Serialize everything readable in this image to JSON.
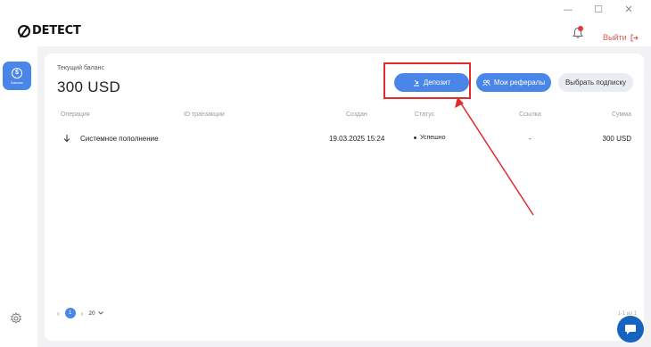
{
  "window": {
    "controls": [
      "—",
      "☐",
      "✕"
    ]
  },
  "header": {
    "logo_text": "DETECT",
    "logout_label": "Выйти"
  },
  "sidebar": {
    "active_item_label": "Баланс",
    "active_item_symbol": "$"
  },
  "balance": {
    "label": "Текущий баланс",
    "value": "300 USD"
  },
  "buttons": {
    "deposit": "Депозит",
    "referrals": "Мои рефералы",
    "subscription": "Выбрать подписку"
  },
  "table": {
    "columns": [
      "Операция",
      "ID транзакции",
      "Создан",
      "Статус",
      "Ссылка",
      "Сумма"
    ],
    "rows": [
      {
        "operation": "Системное пополнение",
        "transaction_id": "",
        "created": "19.03.2025 15:24",
        "status": "Успешно",
        "link": "-",
        "amount": "300 USD"
      }
    ]
  },
  "pagination": {
    "current_page": "1",
    "page_size": "20",
    "range": "1-1 из 1"
  },
  "colors": {
    "accent": "#4a86e8",
    "highlight": "#e12b2b",
    "logout": "#e05a4f"
  },
  "icons": {
    "bell": "bell-icon",
    "logout": "logout-icon",
    "gear": "gear-icon",
    "chat": "chat-icon",
    "deposit": "download-icon",
    "referrals": "users-icon",
    "row_operation": "arrow-down-icon"
  }
}
